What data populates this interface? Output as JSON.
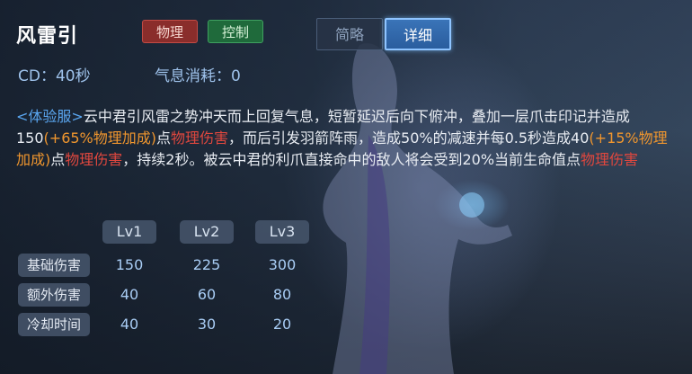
{
  "skill": {
    "name": "风雷引",
    "tags": [
      {
        "label": "物理",
        "color": "#8a2d2b"
      },
      {
        "label": "控制",
        "color": "#1f6a3b"
      }
    ]
  },
  "tabs": {
    "brief": "简略",
    "detail": "详细",
    "active": "detail"
  },
  "stats": {
    "cooldown": "CD：40秒",
    "energy": "气息消耗：0"
  },
  "description": {
    "prefix": "<体验服>",
    "part1": "云中君引风雷之势冲天而上回复气息，短暂延迟后向下俯冲，叠加一层爪击印记并造成150",
    "bonus1": "(+65%物理加成)",
    "part2": "点",
    "dmg1": "物理伤害",
    "part3": "，而后引发羽箭阵雨，造成50%的减速并每0.5秒造成40",
    "bonus2": "(+15%物理加成)",
    "part4": "点",
    "dmg2": "物理伤害",
    "part5": "，持续2秒。被云中君的利爪直接命中的敌人将会受到20%当前生命值点",
    "dmg3": "物理伤害"
  },
  "levels": {
    "headers": [
      "Lv1",
      "Lv2",
      "Lv3"
    ],
    "rows": [
      {
        "label": "基础伤害",
        "values": [
          "150",
          "225",
          "300"
        ]
      },
      {
        "label": "额外伤害",
        "values": [
          "40",
          "60",
          "80"
        ]
      },
      {
        "label": "冷却时间",
        "values": [
          "40",
          "30",
          "20"
        ]
      }
    ]
  },
  "colors": {
    "accent_blue": "#5aa6f0",
    "bonus_orange": "#f0962e",
    "damage_red": "#e0473e"
  }
}
